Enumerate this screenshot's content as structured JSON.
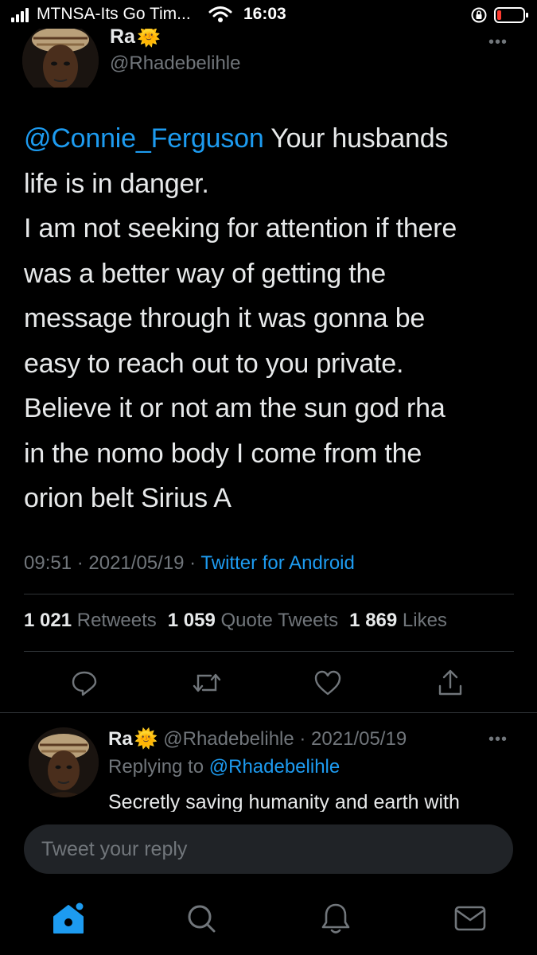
{
  "status_bar": {
    "carrier": "MTNSA-Its Go Tim...",
    "time": "16:03"
  },
  "tweet": {
    "author_name": "Ra",
    "author_emoji": "🌞",
    "author_handle": "@Rhadebelihle",
    "mention": "@Connie_Ferguson",
    "text_lines": [
      " Your husbands",
      "life is in danger.",
      "I am not seeking for attention if there",
      "was a better way of getting the",
      "message through it was gonna be",
      "easy to reach out to you private.",
      "Believe it or not am the sun god rha",
      "in the nomo body I come from the",
      "orion belt Sirius A"
    ],
    "time": "09:51",
    "date": "2021/05/19",
    "separator": " · ",
    "source": "Twitter for Android",
    "stats": {
      "retweets_count": "1 021",
      "retweets_label": "Retweets",
      "quotes_count": "1 059",
      "quotes_label": "Quote Tweets",
      "likes_count": "1 869",
      "likes_label": "Likes"
    }
  },
  "reply": {
    "author_name": "Ra",
    "author_emoji": "🌞",
    "meta": "@Rhadebelihle · 2021/05/19",
    "replying_prefix": "Replying to ",
    "replying_handle": "@Rhadebelihle",
    "text": "Secretly saving humanity and earth with"
  },
  "composer": {
    "placeholder": "Tweet your reply"
  },
  "icons": {
    "reply": "reply-icon",
    "retweet": "retweet-icon",
    "like": "heart-icon",
    "share": "share-icon",
    "home": "home-icon",
    "search": "search-icon",
    "notifications": "bell-icon",
    "messages": "mail-icon"
  },
  "colors": {
    "background": "#000000",
    "accent": "#1d9bf0",
    "text": "#e7e9ea",
    "muted": "#71767b",
    "battery_low": "#ff3b30"
  }
}
